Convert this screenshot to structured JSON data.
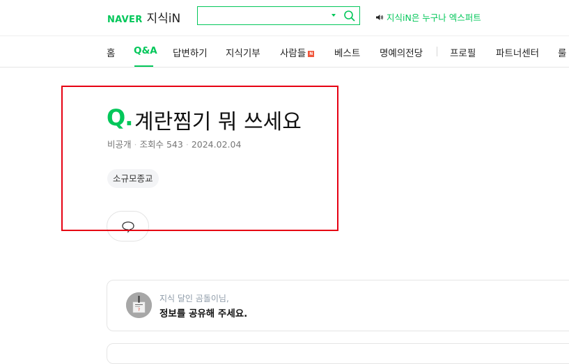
{
  "header": {
    "brand": "NAVER",
    "service": "지식iN",
    "search": {
      "value": "",
      "placeholder": ""
    },
    "promo_text": "지식iN은 누구나 엑스퍼트"
  },
  "nav": {
    "items": [
      {
        "label": "홈"
      },
      {
        "label": "Q&A",
        "active": true
      },
      {
        "label": "답변하기"
      },
      {
        "label": "지식기부"
      },
      {
        "label": "사람들",
        "badge": "N"
      },
      {
        "label": "베스트"
      },
      {
        "label": "명예의전당"
      },
      {
        "label": "프로필"
      },
      {
        "label": "파트너센터"
      },
      {
        "label": "룰"
      }
    ]
  },
  "question": {
    "q_mark": "Q.",
    "title": "계란찜기 뭐 쓰세요",
    "author": "비공개",
    "views": "조회수 543",
    "date": "2024.02.04",
    "tag": "소규모종교"
  },
  "expert_card": {
    "subtitle": "지식 달인 곰돌이님,",
    "message": "정보를 공유해 주세요."
  },
  "colors": {
    "brand_green": "#03c75a",
    "highlight_red": "#e60012"
  }
}
